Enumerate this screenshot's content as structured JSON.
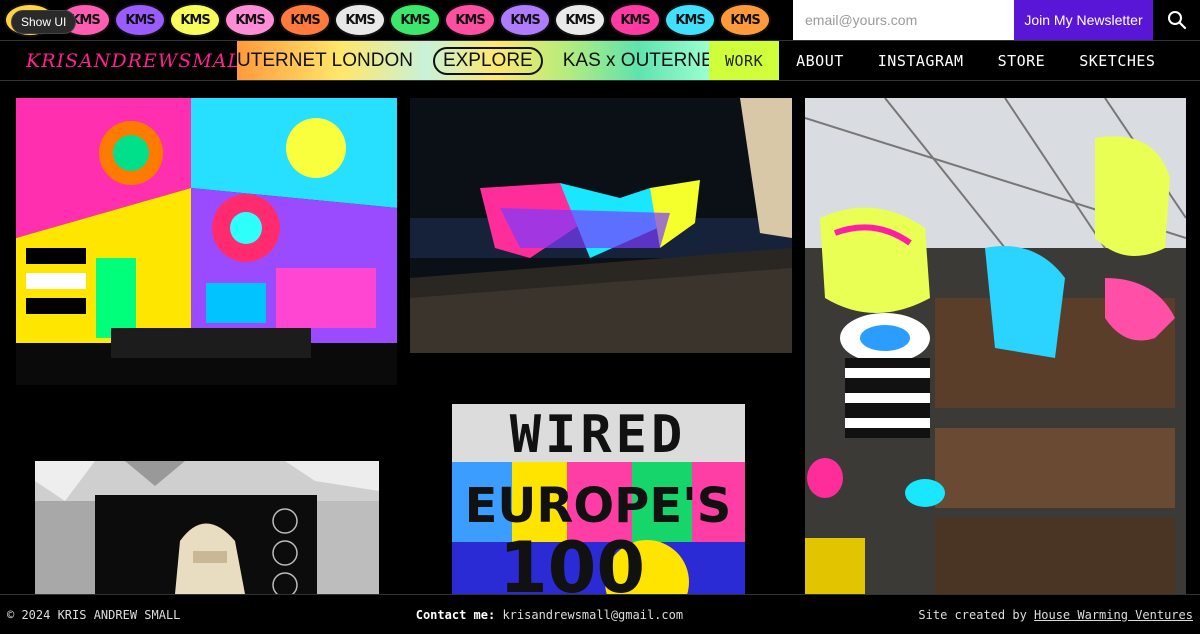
{
  "top_bar": {
    "badge_text": "KMS",
    "show_ui_label": "Show UI",
    "newsletter": {
      "placeholder": "email@yours.com",
      "button_label": "Join My Newsletter"
    },
    "search_icon": "search-icon",
    "badge_colors": [
      "#ffd23f",
      "#ff5db1",
      "#9b5cff",
      "#f9ff5a",
      "#ff8cd6",
      "#ff7a3c",
      "#e8e8e8",
      "#3ce86b",
      "#ff4fa0",
      "#b07cff",
      "#eaeaea",
      "#ff3ba3",
      "#42e0ff",
      "#ff9a3c"
    ]
  },
  "nav": {
    "logo": "KRISANDREWSMALL",
    "ticker": [
      "UTERNET LONDON",
      "EXPLORE",
      "KAS x OUTERNET"
    ],
    "links": [
      {
        "label": "WORK",
        "active": true
      },
      {
        "label": "ABOUT",
        "active": false
      },
      {
        "label": "INSTAGRAM",
        "active": false
      },
      {
        "label": "STORE",
        "active": false
      },
      {
        "label": "SKETCHES",
        "active": false
      }
    ]
  },
  "gallery": {
    "wired_masthead": "WIRED",
    "wired_word": "EUROPE'S",
    "wired_number": "100"
  },
  "footer": {
    "copyright": "© 2024 KRIS ANDREW SMALL",
    "contact_label": "Contact me:",
    "contact_email": "krisandrewsmall@gmail.com",
    "credit_prefix": "Site created by",
    "credit_link": "House Warming Ventures"
  }
}
